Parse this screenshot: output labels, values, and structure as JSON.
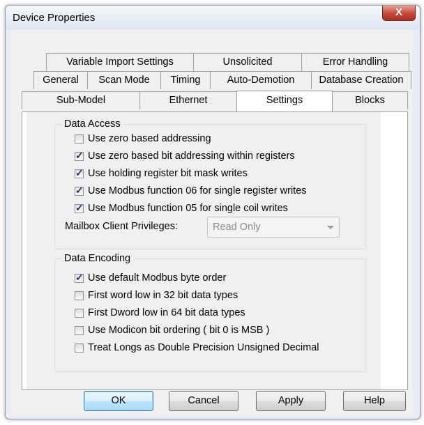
{
  "window": {
    "title": "Device Properties",
    "close_label": "X"
  },
  "tabs": {
    "row1": [
      "Variable Import Settings",
      "Unsolicited",
      "Error Handling"
    ],
    "row2": [
      "General",
      "Scan Mode",
      "Timing",
      "Auto-Demotion",
      "Database Creation"
    ],
    "row3": [
      "Sub-Model",
      "Ethernet",
      "Settings",
      "Blocks"
    ],
    "active": "Settings"
  },
  "data_access": {
    "title": "Data Access",
    "options": [
      {
        "label": "Use zero based addressing",
        "checked": false
      },
      {
        "label": "Use zero based bit addressing within registers",
        "checked": true
      },
      {
        "label": "Use holding register bit mask writes",
        "checked": true
      },
      {
        "label": "Use Modbus function 06 for single register writes",
        "checked": true
      },
      {
        "label": "Use Modbus function 05 for single coil writes",
        "checked": true
      }
    ],
    "mailbox_label": "Mailbox Client Privileges:",
    "mailbox_value": "Read Only"
  },
  "data_encoding": {
    "title": "Data Encoding",
    "options": [
      {
        "label": "Use default Modbus byte order",
        "checked": true
      },
      {
        "label": "First word low in 32 bit data types",
        "checked": false
      },
      {
        "label": "First Dword low in 64 bit data types",
        "checked": false
      },
      {
        "label": "Use Modicon bit ordering ( bit 0 is MSB )",
        "checked": false
      },
      {
        "label": "Treat Longs as Double Precision Unsigned Decimal",
        "checked": false
      }
    ]
  },
  "buttons": {
    "ok": "OK",
    "cancel": "Cancel",
    "apply": "Apply",
    "help": "Help"
  },
  "check_glyph": "✓"
}
